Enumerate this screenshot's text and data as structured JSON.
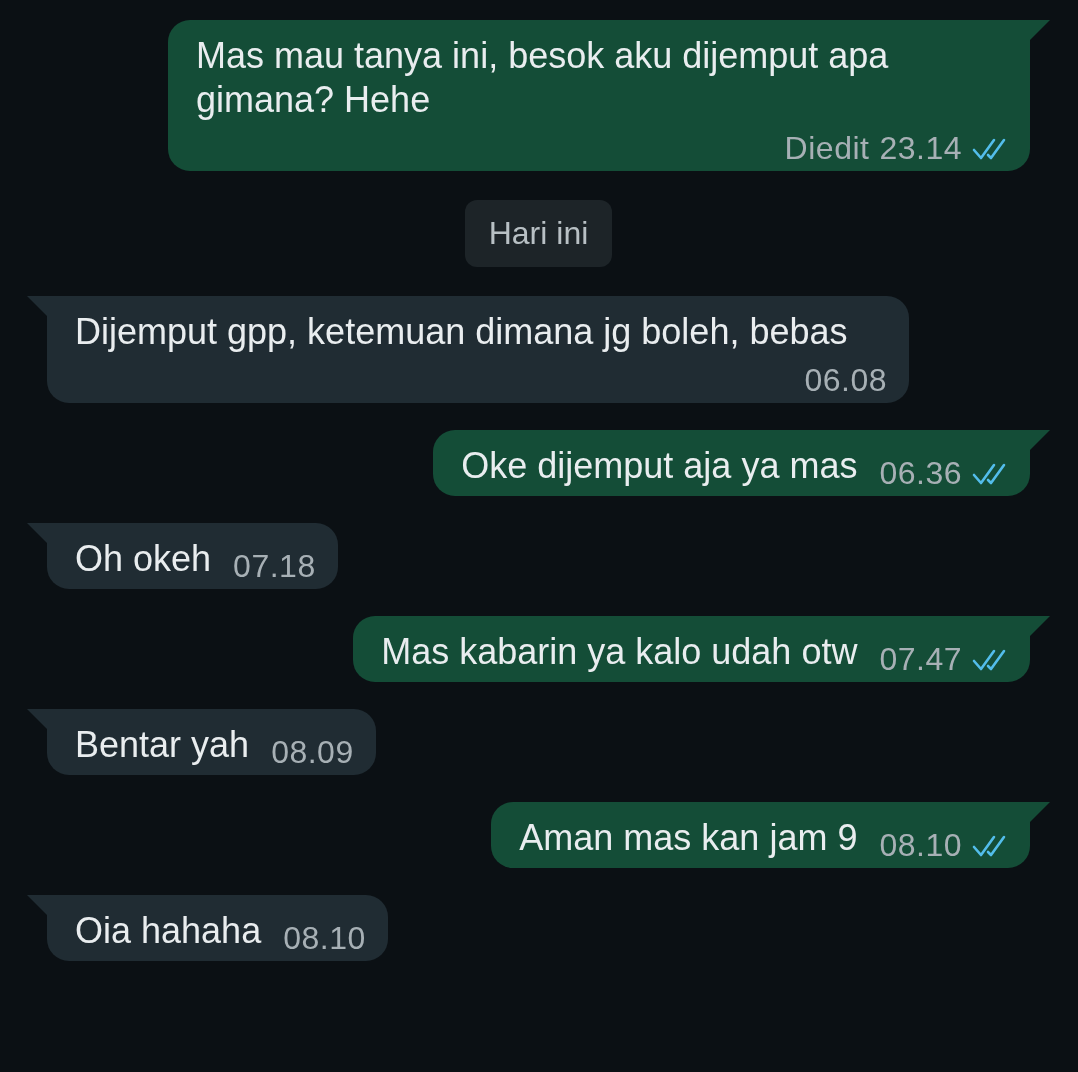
{
  "messages": [
    {
      "kind": "sent",
      "text": "Mas mau tanya ini, besok aku dijemput apa gimana? Hehe",
      "edited": "Diedit",
      "time": "23.14",
      "read": true
    },
    {
      "kind": "date",
      "text": "Hari ini"
    },
    {
      "kind": "received",
      "text": "Dijemput gpp, ketemuan dimana jg boleh, bebas",
      "time": "06.08"
    },
    {
      "kind": "sent",
      "text": "Oke dijemput aja ya mas",
      "time": "06.36",
      "read": true
    },
    {
      "kind": "received",
      "text": "Oh okeh",
      "time": "07.18"
    },
    {
      "kind": "sent",
      "text": "Mas kabarin ya kalo udah otw",
      "time": "07.47",
      "read": true
    },
    {
      "kind": "received",
      "text": "Bentar yah",
      "time": "08.09"
    },
    {
      "kind": "sent",
      "text": "Aman mas kan jam 9",
      "time": "08.10",
      "read": true
    },
    {
      "kind": "received",
      "text": "Oia hahaha",
      "time": "08.10"
    }
  ]
}
